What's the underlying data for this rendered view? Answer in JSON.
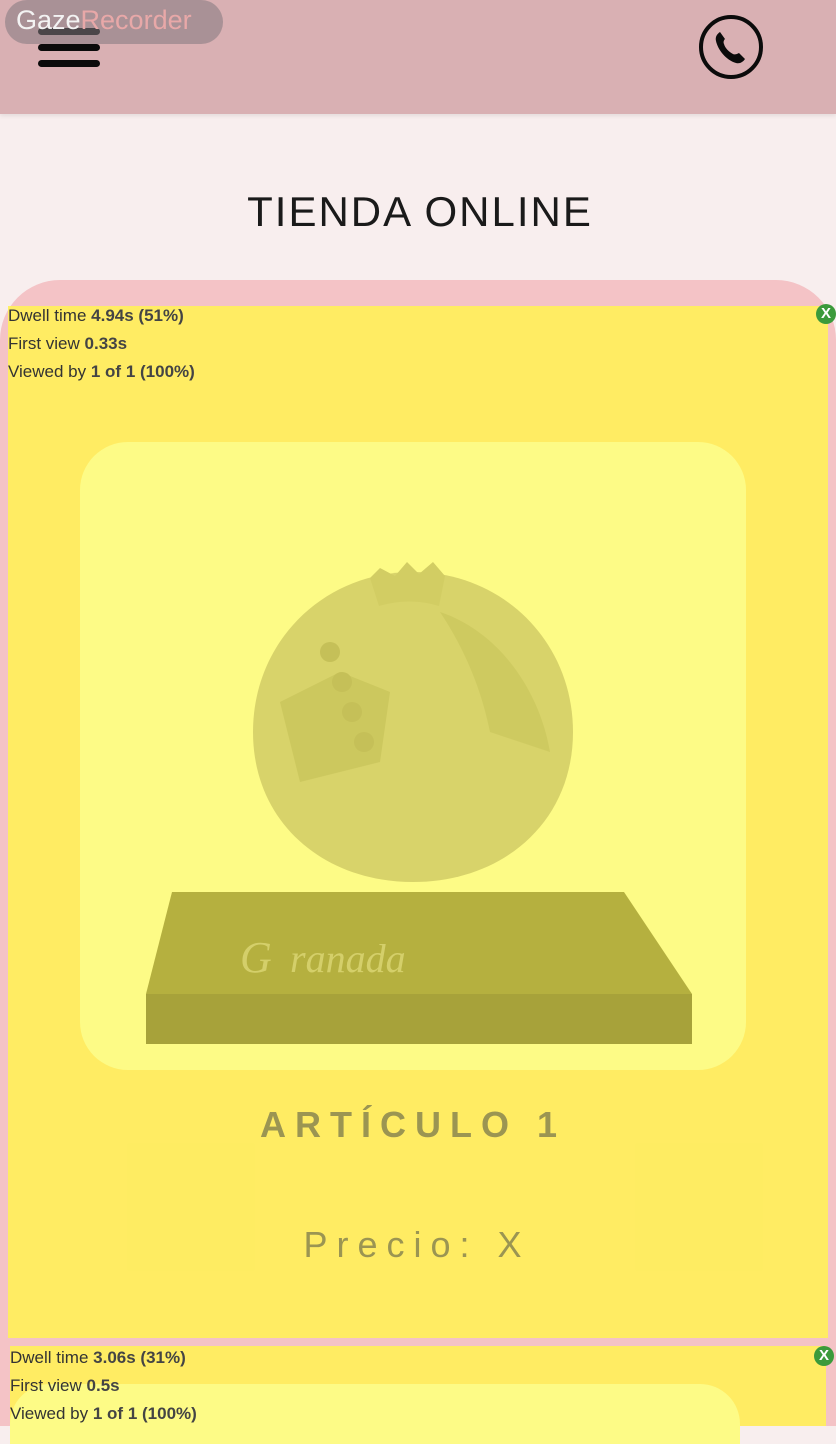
{
  "recorder": {
    "brand_part1": "Gaze",
    "brand_part2": "Recorder"
  },
  "page": {
    "title": "TIENDA ONLINE"
  },
  "product": {
    "name": "ARTÍCULO 1",
    "price": "Precio: X",
    "image_text": "ranada"
  },
  "region1": {
    "dwell_label": "Dwell time",
    "dwell_value": "4.94s (51%)",
    "first_label": "First view",
    "first_value": "0.33s",
    "viewed_label": "Viewed by",
    "viewed_value": "1 of 1 (100%)",
    "close": "X"
  },
  "region2": {
    "dwell_label": "Dwell time",
    "dwell_value": "3.06s (31%)",
    "first_label": "First view",
    "first_value": "0.5s",
    "viewed_label": "Viewed by",
    "viewed_value": "1 of 1 (100%)",
    "close": "X"
  },
  "colors": {
    "header": "#d9b0b3",
    "card": "#f4c3c6",
    "heatmap": "#fff05a"
  },
  "icons": [
    "hamburger-menu-icon",
    "phone-icon",
    "close-icon"
  ]
}
